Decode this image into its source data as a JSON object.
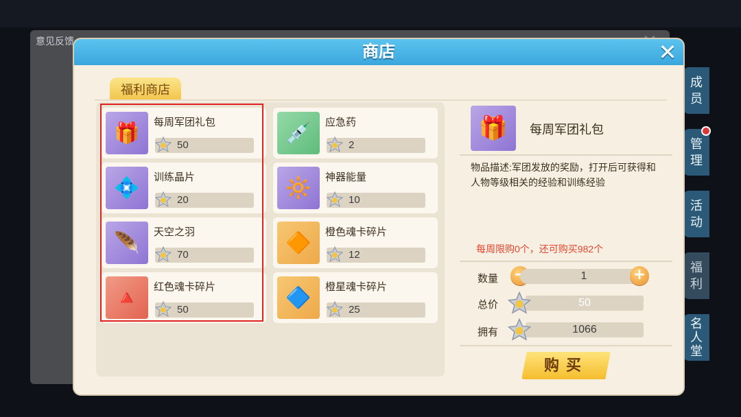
{
  "background": {
    "feedback_label": "意见反馈",
    "side_buttons": [
      "成员",
      "管理",
      "活动",
      "福利",
      "名人堂"
    ]
  },
  "shop": {
    "title": "商店",
    "close_icon": "close-icon",
    "tab_label": "福利商店",
    "items": [
      {
        "name": "每周军团礼包",
        "price": "50",
        "icon": "gift-box-icon",
        "color": "purple"
      },
      {
        "name": "应急药",
        "price": "2",
        "icon": "syringe-icon",
        "color": "green"
      },
      {
        "name": "训练晶片",
        "price": "20",
        "icon": "chip-icon",
        "color": "purple"
      },
      {
        "name": "神器能量",
        "price": "10",
        "icon": "energy-orb-icon",
        "color": "purple"
      },
      {
        "name": "天空之羽",
        "price": "70",
        "icon": "feather-icon",
        "color": "purple"
      },
      {
        "name": "橙色魂卡碎片",
        "price": "12",
        "icon": "card-shard-icon",
        "color": "orange"
      },
      {
        "name": "红色魂卡碎片",
        "price": "50",
        "icon": "card-shard-icon",
        "color": "red"
      },
      {
        "name": "橙星魂卡碎片",
        "price": "25",
        "icon": "card-shard-icon",
        "color": "orange"
      }
    ]
  },
  "detail": {
    "name": "每周军团礼包",
    "description": "物品描述:军团发放的奖励，打开后可获得和人物等级相关的经验和训练经验",
    "limit_text": "每周限购0个，还可购买982个",
    "quantity_label": "数量",
    "quantity": "1",
    "total_label": "总价",
    "total": "50",
    "owned_label": "拥有",
    "owned": "1066",
    "buy_label": "购买"
  },
  "colors": {
    "header_blue": "#3aa6dc",
    "highlight_red": "#e12020",
    "limit_text_red": "#e4442f",
    "buy_gold": "#f5bd2e"
  }
}
